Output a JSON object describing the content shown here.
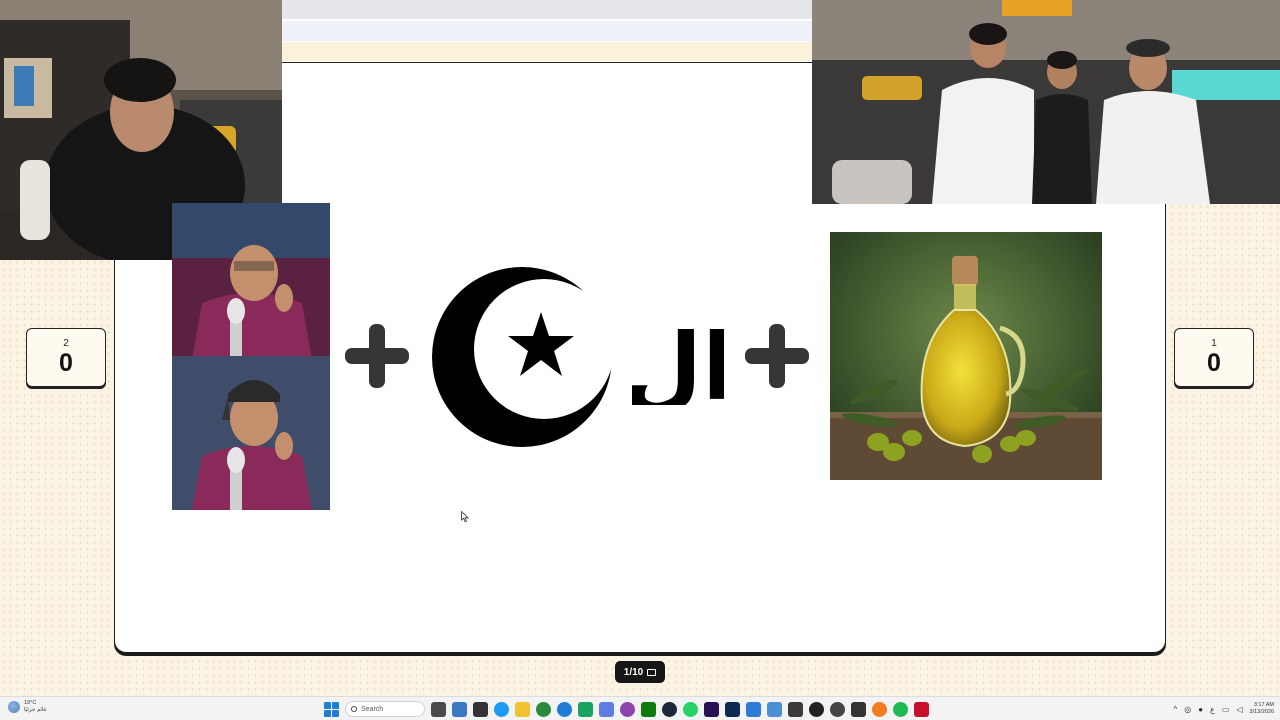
{
  "game": {
    "scores": {
      "left": {
        "team_number": "2",
        "score": "0"
      },
      "right": {
        "team_number": "1",
        "score": "0"
      }
    },
    "puzzle": {
      "plus_sign": "+",
      "arabic_text": "ال",
      "photo_left": "host-photo",
      "crescent": "crescent-star-icon",
      "photo_right": "olive-oil-photo"
    },
    "page_indicator": "1/10"
  },
  "taskbar": {
    "weather_temp": "19°C",
    "weather_desc": "غائم جزئيًا",
    "search_placeholder": "Search",
    "language": "ع",
    "time": "3:17 AM",
    "date": "3/13/2026"
  },
  "colors": {
    "background": "#fbf3e3",
    "card": "#ffffff",
    "border": "#1d1d1d",
    "taskbar": "#f3f3f3"
  }
}
